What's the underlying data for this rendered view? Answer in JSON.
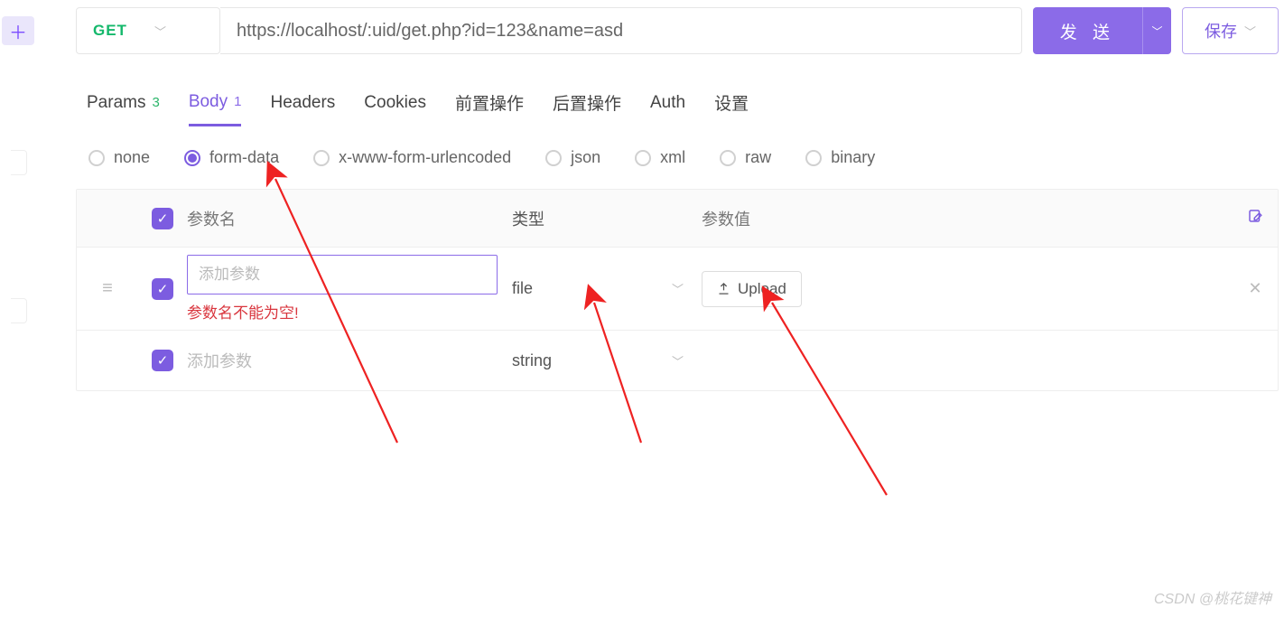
{
  "request": {
    "method": "GET",
    "url": "https://localhost/:uid/get.php?id=123&name=asd",
    "send_label": "发 送",
    "save_label": "保存"
  },
  "tabs": {
    "params": {
      "label": "Params",
      "count": "3"
    },
    "body": {
      "label": "Body",
      "count": "1"
    },
    "headers": {
      "label": "Headers"
    },
    "cookies": {
      "label": "Cookies"
    },
    "pre": {
      "label": "前置操作"
    },
    "post": {
      "label": "后置操作"
    },
    "auth": {
      "label": "Auth"
    },
    "settings": {
      "label": "设置"
    }
  },
  "body_types": {
    "none": "none",
    "form_data": "form-data",
    "x_www": "x-www-form-urlencoded",
    "json": "json",
    "xml": "xml",
    "raw": "raw",
    "binary": "binary"
  },
  "table": {
    "head": {
      "name": "参数名",
      "type": "类型",
      "value": "参数值"
    },
    "placeholder_name": "添加参数",
    "error_name_empty": "参数名不能为空!",
    "rows": [
      {
        "type": "file",
        "upload_label": "Upload"
      },
      {
        "type": "string"
      }
    ]
  },
  "watermark": "CSDN @桃花键神"
}
